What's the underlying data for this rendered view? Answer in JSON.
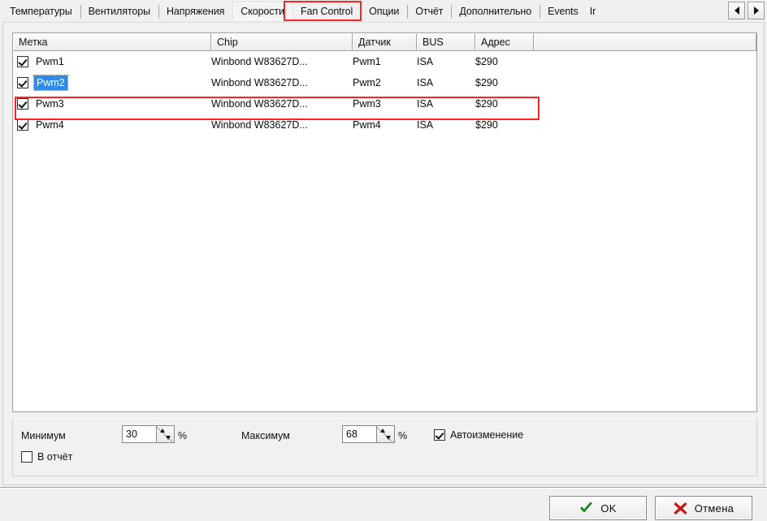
{
  "tabs": [
    {
      "label": "Температуры",
      "active": false
    },
    {
      "label": "Вентиляторы",
      "active": false
    },
    {
      "label": "Напряжения",
      "active": false
    },
    {
      "label": "Скорости",
      "active": true
    },
    {
      "label": "Fan Control",
      "active": false
    },
    {
      "label": "Опции",
      "active": false
    },
    {
      "label": "Отчёт",
      "active": false
    },
    {
      "label": "Дополнительно",
      "active": false
    },
    {
      "label": "Events",
      "active": false
    },
    {
      "label": "Ir",
      "active": false
    }
  ],
  "tab_scroll": {
    "prev_icon": "triangle-left-icon",
    "next_icon": "triangle-right-icon"
  },
  "list": {
    "columns": [
      {
        "key": "label",
        "title": "Метка"
      },
      {
        "key": "chip",
        "title": "Chip"
      },
      {
        "key": "sensor",
        "title": "Датчик"
      },
      {
        "key": "bus",
        "title": "BUS"
      },
      {
        "key": "address",
        "title": "Адрес"
      }
    ],
    "rows": [
      {
        "checked": true,
        "label": "Pwm1",
        "chip": "Winbond W83627D...",
        "sensor": "Pwm1",
        "bus": "ISA",
        "address": "$290",
        "selected": false
      },
      {
        "checked": true,
        "label": "Pwm2",
        "chip": "Winbond W83627D...",
        "sensor": "Pwm2",
        "bus": "ISA",
        "address": "$290",
        "selected": true
      },
      {
        "checked": true,
        "label": "Pwm3",
        "chip": "Winbond W83627D...",
        "sensor": "Pwm3",
        "bus": "ISA",
        "address": "$290",
        "selected": false
      },
      {
        "checked": true,
        "label": "Pwm4",
        "chip": "Winbond W83627D...",
        "sensor": "Pwm4",
        "bus": "ISA",
        "address": "$290",
        "selected": false
      }
    ]
  },
  "settings": {
    "minimum_label": "Минимум",
    "minimum_value": "30",
    "minimum_unit": "%",
    "maximum_label": "Максимум",
    "maximum_value": "68",
    "maximum_unit": "%",
    "autochange_label": "Автоизменение",
    "autochange_checked": true,
    "report_label": "В отчёт",
    "report_checked": false
  },
  "footer": {
    "ok_label": "OK",
    "ok_icon": "check-mark-icon",
    "cancel_label": "Отмена",
    "cancel_icon": "red-x-icon"
  },
  "annotations": {
    "tab_highlight_color": "#fb2323",
    "row_highlight_color": "#fb2323",
    "selection_color": "#2f8ae8"
  }
}
